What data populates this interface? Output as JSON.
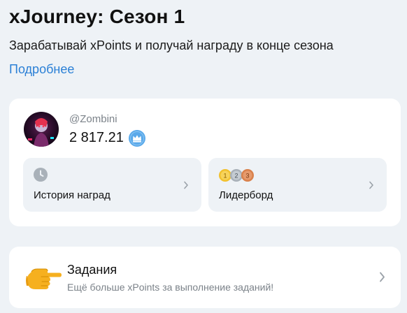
{
  "header": {
    "title": "xJourney: Сезон 1",
    "subtitle": "Зарабатывай xPoints и получай награду в конце сезона",
    "more_link": "Подробнее"
  },
  "profile": {
    "username": "@Zombini",
    "points": "2 817.21",
    "badge_icon": "crown-icon",
    "tiles": [
      {
        "label": "История наград",
        "icon": "clock-icon"
      },
      {
        "label": "Лидерборд",
        "icon": "medals-icon",
        "medals": [
          "1",
          "2",
          "3"
        ]
      }
    ]
  },
  "tasks": {
    "title": "Задания",
    "description": "Ещё больше xPoints за выполнение заданий!",
    "icon": "pointing-hand-icon"
  },
  "colors": {
    "background": "#eef2f6",
    "link": "#2b80d6",
    "badge": "#5aa9ea",
    "gold": "#f2c12e",
    "silver": "#a9b1b9",
    "bronze": "#d9814c"
  }
}
